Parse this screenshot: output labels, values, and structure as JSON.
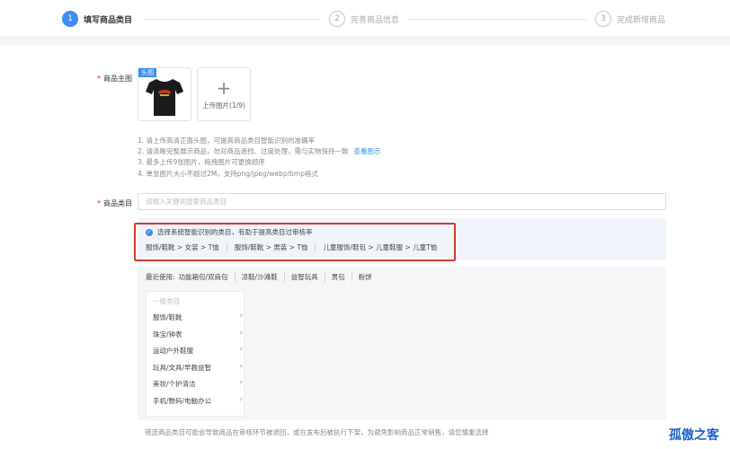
{
  "steps": [
    {
      "num": "1",
      "label": "填写商品类目"
    },
    {
      "num": "2",
      "label": "完善商品信息"
    },
    {
      "num": "3",
      "label": "完成新增商品"
    }
  ],
  "main_image": {
    "required_mark": "*",
    "label": "商品主图",
    "head_tag": "头图",
    "upload_label": "上传图片(1/9)"
  },
  "tips": {
    "line1": "1. 请上传高清正面头图，可提高商品类目智能识别的准确率",
    "line2": "2. 请清晰完整展示商品，勿对商品遮挡、过度处理，需与实物保持一致",
    "line2_link": "查看图示",
    "line3": "3. 最多上传9张图片，拖拽图片可更换顺序",
    "line4": "4. 单张图片大小不超过2M，支持png/jpeg/webp/bmp格式"
  },
  "category": {
    "required_mark": "*",
    "label": "商品类目",
    "placeholder": "请输入关键词搜索商品类目"
  },
  "suggest": {
    "title": "选择系统智能识别的类目，有助于提高类目过审核率",
    "options": [
      "服饰/鞋靴 > 女装 > T恤",
      "服饰/鞋靴 > 男装 > T恤",
      "儿童服饰/鞋包 > 儿童鞋服 > 儿童T恤"
    ]
  },
  "recent": {
    "label": "最近使用:",
    "items": [
      "功能箱包/双肩包",
      "凉鞋/沙滩鞋",
      "益智玩具",
      "男包",
      "粉饼"
    ]
  },
  "cat_list": {
    "header": "一级类目",
    "items": [
      "服饰/鞋靴",
      "珠宝/钟表",
      "运动户外鞋服",
      "玩具/文具/早教益智",
      "美妆/个护清洁",
      "手机/数码/电脑办公"
    ]
  },
  "footnote": "错选商品类目可能会导致商品在审核环节被退回，或在发布后被执行下架，为避免影响商品正常销售，请您慎重选择",
  "watermark": "孤傲之客",
  "colors": {
    "accent": "#3d8ef0",
    "highlight_border": "#d23c2a",
    "required": "#e5322d"
  }
}
